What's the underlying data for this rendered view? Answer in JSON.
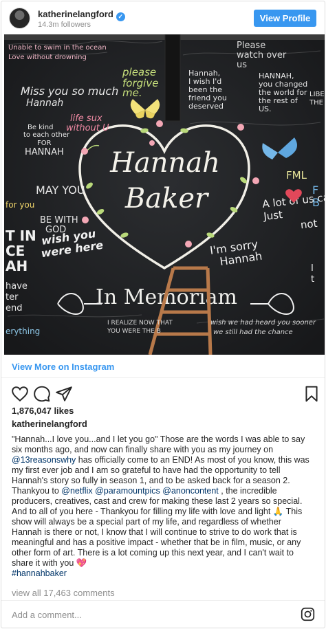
{
  "header": {
    "username": "katherinelangford",
    "verified_icon": "verified-badge-icon",
    "followers": "14.3m followers",
    "view_profile_label": "View Profile"
  },
  "photo": {
    "title_line1": "Hannah",
    "title_line2": "Baker",
    "memoriam": "In Memoriam",
    "notes": [
      "I'm sorry hannah",
      "wish you were here",
      "A lot of us can just not",
      "FML",
      "please forgive me",
      "Please watch over us",
      "Miss you so much Hannah",
      "Be kind to each other FOR HANNAH",
      "May you BE WITH GOD",
      "HANNAH, you changed the world for the rest of US.",
      "Hannah, I wish I'd been the friend you deserved",
      "I REALIZE NOW THAT YOU WERE THE B",
      "wish we had heard you sooner we still had the chance",
      "LIBE THE",
      "IT IN CE AH",
      "have ter end",
      "for you",
      "life sux without U"
    ]
  },
  "links": {
    "view_more": "View More on Instagram"
  },
  "actions": {
    "like_icon": "heart-icon",
    "comment_icon": "comment-bubble-icon",
    "share_icon": "share-paper-plane-icon",
    "save_icon": "bookmark-icon"
  },
  "likes": "1,876,047 likes",
  "caption": {
    "username": "katherinelangford",
    "line1": "\"Hannah...I love you...and I let you go\" Those are the words I was able to say",
    "line2": "six months ago, and now can finally share with you as my journey on",
    "mention_13rw": "@13reasonswhy",
    "line3_rest": " has officially come to an END! As most of you know, this was",
    "line4": "my first ever job and I am so grateful to have had the opportunity to tell",
    "line5": "Hannah's story so fully in season 1, and to be asked back for a season 2.",
    "line6_pre": "Thankyou to ",
    "mention_netflix": "@netflix",
    "mention_paramount": "@paramountpics",
    "mention_anon": "@anoncontent",
    "line6_post": " , the incredible",
    "line7": "producers, creatives, cast and crew for making these last 2 years so special.",
    "line8": "And to all of you here - Thankyou for filling my life with love and light 🙏 This",
    "line9": "show will always be a special part of my life, and regardless of whether",
    "line10": "Hannah is there or not, I know that I will continue to strive to do work that is",
    "line11": "meaningful and has a positive impact - whether that be in film, music, or any",
    "line12": "other form of art. There is a lot coming up this next year, and I can't wait to",
    "line13": "share it with you 💖",
    "hashtag": "#hannahbaker"
  },
  "view_all_comments": "view all 17,463 comments",
  "comment_box": {
    "placeholder": "Add a comment..."
  },
  "footer": {
    "logo_icon": "instagram-logo-icon"
  },
  "colors": {
    "accent": "#3897f0",
    "link": "#003569",
    "muted": "#8e8e8e",
    "chalkboard": "#1f2022"
  }
}
